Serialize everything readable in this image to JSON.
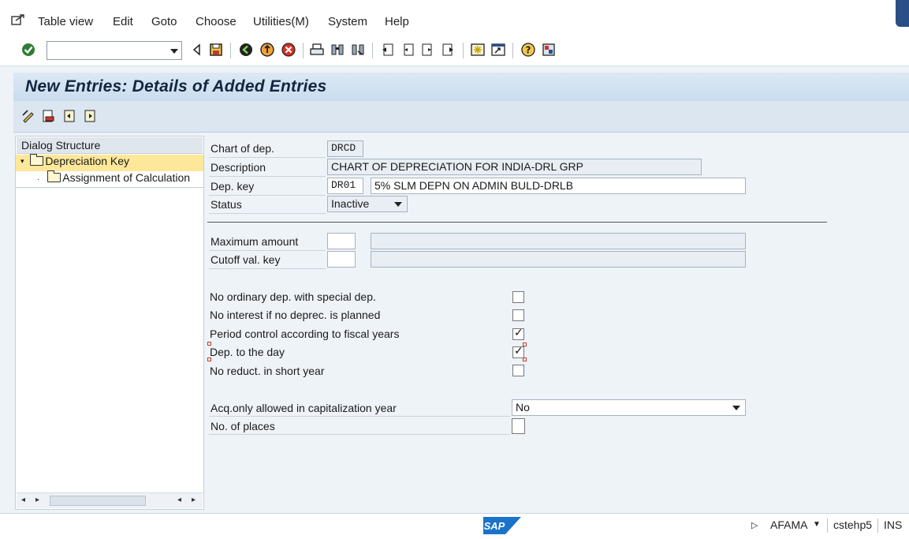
{
  "menu": {
    "items": [
      {
        "label": "Table view"
      },
      {
        "label": "Edit"
      },
      {
        "label": "Goto"
      },
      {
        "label": "Choose"
      },
      {
        "label": "Utilities(M)"
      },
      {
        "label": "System"
      },
      {
        "label": "Help"
      }
    ]
  },
  "toolbar": {
    "command_value": "",
    "icons": [
      "enter-icon",
      "back-icon",
      "save-icon",
      "back-green-icon",
      "exit-icon",
      "cancel-icon",
      "print-icon",
      "find-icon",
      "find-next-icon",
      "first-page-icon",
      "previous-page-icon",
      "next-page-icon",
      "last-page-icon",
      "create-session-icon",
      "shortcut-icon",
      "help-icon",
      "layout-menu-icon"
    ]
  },
  "title": "New Entries: Details of Added Entries",
  "dialog_structure": {
    "header": "Dialog Structure",
    "items": [
      {
        "label": "Depreciation Key",
        "selected": true
      },
      {
        "label": "Assignment of Calculation",
        "selected": false
      }
    ]
  },
  "form": {
    "chart_of_dep": {
      "label": "Chart of dep.",
      "value": "DRCD"
    },
    "description": {
      "label": "Description",
      "value": "CHART OF DEPRECIATION FOR INDIA-DRL GRP"
    },
    "dep_key": {
      "label": "Dep. key",
      "value": "DR01",
      "text": "5% SLM DEPN ON ADMIN BULD-DRLB"
    },
    "status": {
      "label": "Status",
      "value": "Inactive"
    },
    "maximum_amount": {
      "label": "Maximum amount",
      "value": "",
      "text": ""
    },
    "cutoff_val_key": {
      "label": "Cutoff val. key",
      "value": "",
      "text": ""
    },
    "checkboxes": [
      {
        "label": "No ordinary dep. with special dep.",
        "checked": false
      },
      {
        "label": "No interest if no deprec. is planned",
        "checked": false
      },
      {
        "label": "Period control according to fiscal years",
        "checked": true
      },
      {
        "label": "Dep. to the day",
        "checked": true
      },
      {
        "label": "No reduct. in short year",
        "checked": false
      }
    ],
    "acq_only": {
      "label": "Acq.only allowed in capitalization year",
      "value": "No"
    },
    "no_of_places": {
      "label": "No. of places",
      "checked": false
    }
  },
  "statusbar": {
    "logo": "SAP",
    "transaction": "AFAMA",
    "server": "cstehp5",
    "mode": "INS"
  }
}
